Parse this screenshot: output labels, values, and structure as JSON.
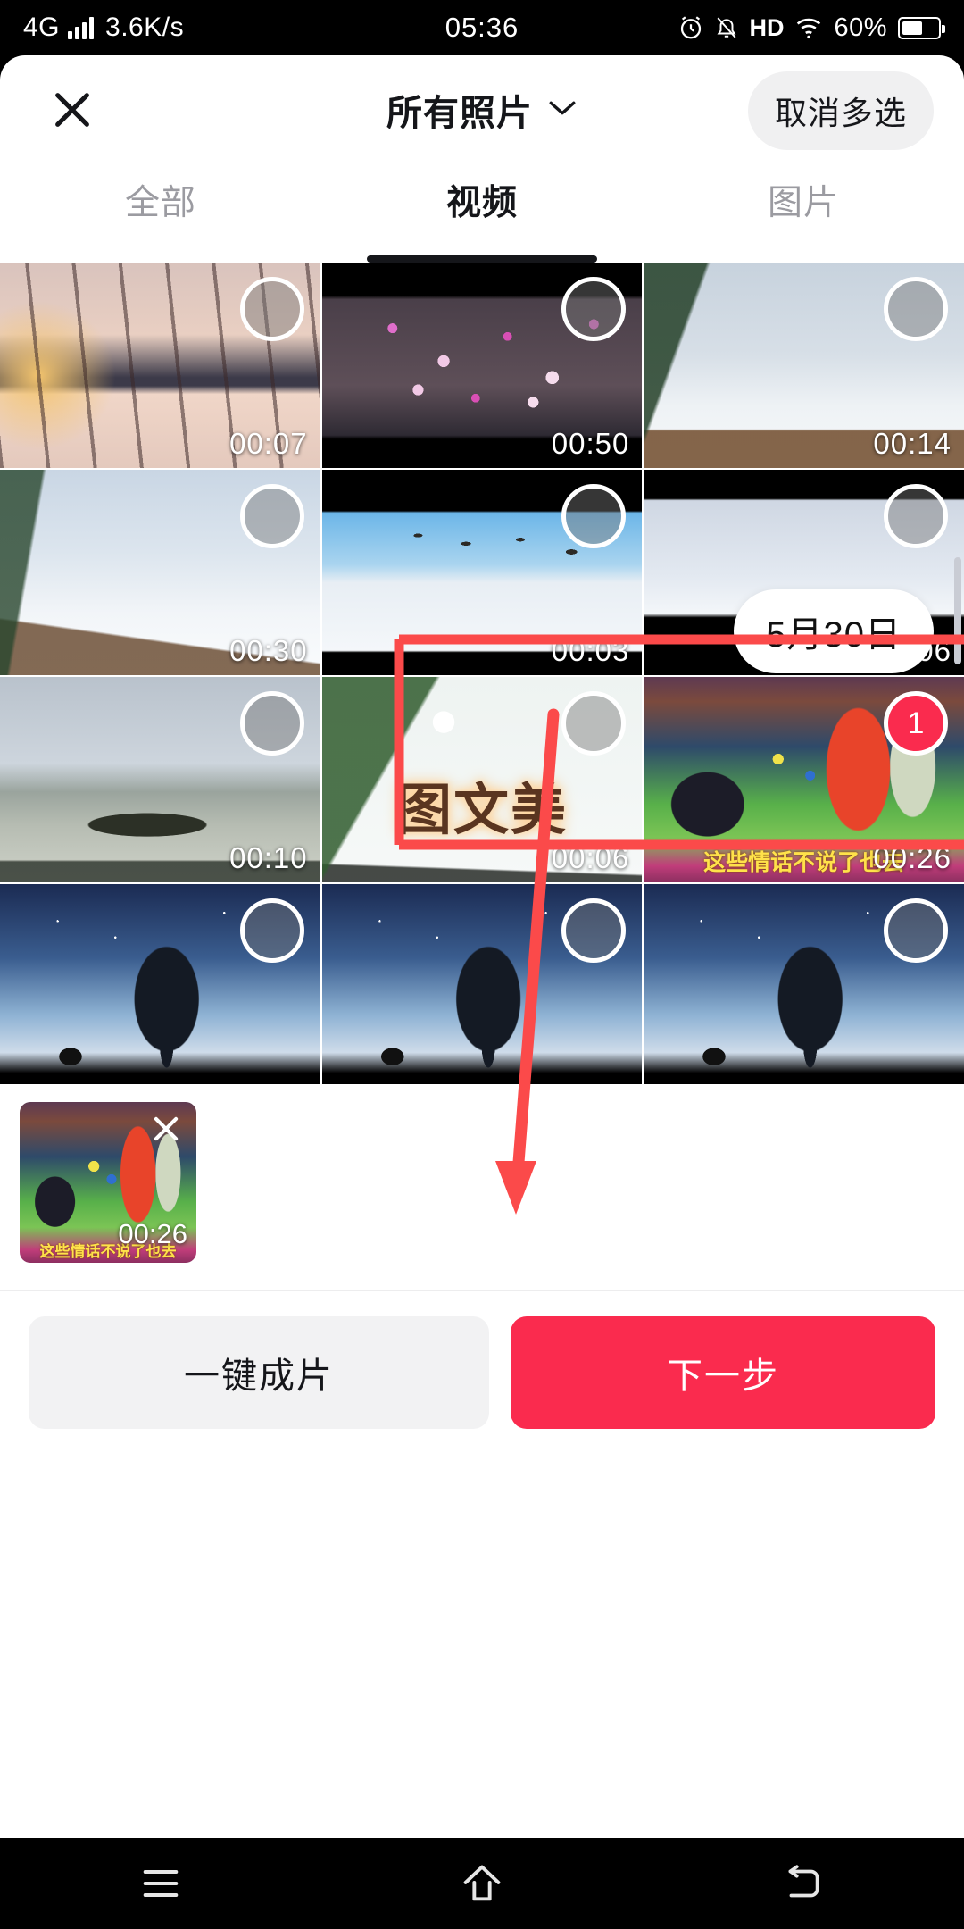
{
  "status_bar": {
    "network": "4G",
    "speed": "3.6K/s",
    "time": "05:36",
    "hd": "HD",
    "battery_percent": "60%",
    "icons": [
      "signal-icon",
      "alarm-icon",
      "mute-icon",
      "hd-icon",
      "wifi-icon",
      "battery-icon"
    ]
  },
  "header": {
    "close_icon": "close-icon",
    "title": "所有照片",
    "chevron_icon": "chevron-down-icon",
    "multiselect_label": "取消多选"
  },
  "tabs": [
    {
      "label": "全部",
      "active": false
    },
    {
      "label": "视频",
      "active": true
    },
    {
      "label": "图片",
      "active": false
    }
  ],
  "date_chip": "5月30日",
  "grid": {
    "items": [
      {
        "duration": "00:07",
        "selected": false,
        "badge": "",
        "watermark": "",
        "caption": ""
      },
      {
        "duration": "00:50",
        "selected": false,
        "badge": "",
        "watermark": "",
        "caption": ""
      },
      {
        "duration": "00:14",
        "selected": false,
        "badge": "",
        "watermark": "",
        "caption": ""
      },
      {
        "duration": "00:30",
        "selected": false,
        "badge": "",
        "watermark": "",
        "caption": ""
      },
      {
        "duration": "00:03",
        "selected": false,
        "badge": "",
        "watermark": "",
        "caption": ""
      },
      {
        "duration": "00:06",
        "selected": false,
        "badge": "",
        "watermark": "",
        "caption": ""
      },
      {
        "duration": "00:10",
        "selected": false,
        "badge": "",
        "watermark": "",
        "caption": ""
      },
      {
        "duration": "00:06",
        "selected": false,
        "badge": "",
        "watermark": "图文美",
        "caption": ""
      },
      {
        "duration": "00:26",
        "selected": true,
        "badge": "1",
        "watermark": "",
        "caption": "这些情话不说了也去"
      },
      {
        "duration": "",
        "selected": false,
        "badge": "",
        "watermark": "",
        "caption": ""
      },
      {
        "duration": "",
        "selected": false,
        "badge": "",
        "watermark": "",
        "caption": ""
      },
      {
        "duration": "",
        "selected": false,
        "badge": "",
        "watermark": "",
        "caption": ""
      }
    ]
  },
  "selected_strip": {
    "remove_icon": "close-icon",
    "duration": "00:26",
    "caption": "这些情话不说了也去"
  },
  "actions": {
    "secondary_label": "一键成片",
    "primary_label": "下一步"
  },
  "nav_bar": {
    "menu_icon": "menu-icon",
    "home_icon": "home-icon",
    "back_icon": "back-icon"
  },
  "annotation": {
    "color": "#fb4a4a",
    "shapes": [
      "highlight-rectangle",
      "pointer-arrow"
    ]
  },
  "colors": {
    "primary": "#fa2b4e",
    "badge": "#fa2b4e",
    "annotation": "#fb4a4a",
    "ghost_button": "#f2f2f3"
  }
}
